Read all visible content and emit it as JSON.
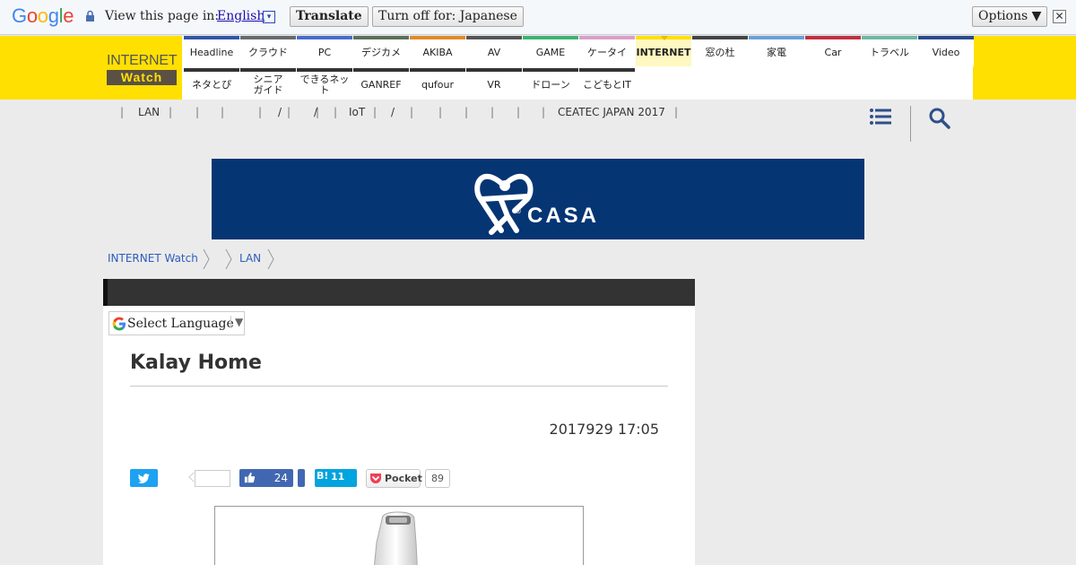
{
  "translate_bar": {
    "logo_letters": [
      "G",
      "o",
      "o",
      "g",
      "l",
      "e"
    ],
    "logo_colors": [
      "#4285f4",
      "#ea4335",
      "#fbbc05",
      "#4285f4",
      "#34a853",
      "#ea4335"
    ],
    "view_label": "View this page in:",
    "language": "English",
    "language_arrow": "▾",
    "translate_label": "Translate",
    "turn_off_label": "Turn off for: Japanese",
    "options_label": "Options ▼",
    "close_glyph": "✕"
  },
  "site": {
    "logo_top": "INTERNET",
    "logo_bottom": "Watch"
  },
  "nav": {
    "row1": [
      {
        "label": "Headline",
        "color": "#3355a8"
      },
      {
        "label": "クラウド",
        "color": "#6a6a6a"
      },
      {
        "label": "PC",
        "color": "#4a6bcc"
      },
      {
        "label": "デジカメ",
        "color": "#5a6f5a"
      },
      {
        "label": "AKIBA",
        "color": "#e08a2a"
      },
      {
        "label": "AV",
        "color": "#555555"
      },
      {
        "label": "GAME",
        "color": "#3cb371"
      },
      {
        "label": "ケータイ",
        "color": "#d8a0c8"
      },
      {
        "label": "INTERNET",
        "color": "#ffe000",
        "active": true
      },
      {
        "label": "窓の杜",
        "color": "#444444"
      },
      {
        "label": "家電",
        "color": "#6aa0d8"
      },
      {
        "label": "Car",
        "color": "#c03040"
      },
      {
        "label": "トラベル",
        "color": "#70b8a0"
      },
      {
        "label": "Video",
        "color": "#2a4a8c"
      }
    ],
    "row2": [
      {
        "label": "ネタとぴ",
        "color": "#333333"
      },
      {
        "label": "シニア\nガイド",
        "color": "#333333"
      },
      {
        "label": "できるネット",
        "color": "#333333"
      },
      {
        "label": "GANREF",
        "color": "#333333"
      },
      {
        "label": "qufour",
        "color": "#333333"
      },
      {
        "label": "VR",
        "color": "#333333"
      },
      {
        "label": "ドローン",
        "color": "#333333"
      },
      {
        "label": "こどもとIT",
        "color": "#333333"
      }
    ]
  },
  "subnav": {
    "separator": "|",
    "items": [
      "LAN",
      "",
      "",
      "",
      "/",
      "/",
      "IoT",
      "/",
      "",
      "",
      "",
      "",
      "",
      "CEATEC JAPAN 2017"
    ]
  },
  "banner": {
    "text": "CASA",
    "registered": "®",
    "bg": "#063574"
  },
  "breadcrumb": [
    "INTERNET Watch",
    "",
    "LAN"
  ],
  "article": {
    "select_language": "Select Language",
    "select_arrow": "▼",
    "title": "Kalay Home",
    "date": "2017929 17:05"
  },
  "social": {
    "like_count": "24",
    "hatena_label": "B!",
    "hatena_count": "11",
    "pocket_label": "Pocket",
    "pocket_count": "89"
  }
}
